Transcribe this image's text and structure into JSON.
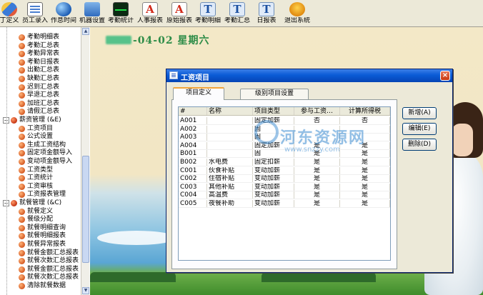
{
  "toolbar": {
    "buttons": [
      {
        "label": "丁定义",
        "icon": "users-icon"
      },
      {
        "label": "员工录入",
        "icon": "document-icon"
      },
      {
        "label": "作息时间",
        "icon": "globe-icon"
      },
      {
        "label": "机器设置",
        "icon": "computer-icon"
      },
      {
        "label": "考勤统计",
        "icon": "waveform-icon"
      },
      {
        "label": "人事报表",
        "icon": "report-a-icon"
      },
      {
        "label": "原始报表",
        "icon": "report-a-icon"
      },
      {
        "label": "考勤明细",
        "icon": "text-t-icon"
      },
      {
        "label": "考勤汇总",
        "icon": "text-t-icon"
      },
      {
        "label": "日报表",
        "icon": "text-t-icon"
      },
      {
        "label": "退出系统",
        "icon": "exit-icon"
      }
    ]
  },
  "sidebar": {
    "items": [
      {
        "label": "考勤明细表",
        "level": 2
      },
      {
        "label": "考勤汇总表",
        "level": 2
      },
      {
        "label": "考勤异常表",
        "level": 2
      },
      {
        "label": "考勤日报表",
        "level": 2
      },
      {
        "label": "出勤汇总表",
        "level": 2
      },
      {
        "label": "缺勤汇总表",
        "level": 2
      },
      {
        "label": "迟到汇总表",
        "level": 2
      },
      {
        "label": "早退汇总表",
        "level": 2
      },
      {
        "label": "加班汇总表",
        "level": 2
      },
      {
        "label": "请假汇总表",
        "level": 2
      },
      {
        "label": "薪资管理 (&E)",
        "level": 1
      },
      {
        "label": "工资项目",
        "level": 2
      },
      {
        "label": "公式设置",
        "level": 2
      },
      {
        "label": "生成工资结构",
        "level": 2
      },
      {
        "label": "固定项金额导入",
        "level": 2
      },
      {
        "label": "变动项金额导入",
        "level": 2
      },
      {
        "label": "工资类型",
        "level": 2
      },
      {
        "label": "工资统计",
        "level": 2
      },
      {
        "label": "工资审核",
        "level": 2
      },
      {
        "label": "工资报表管理",
        "level": 2
      },
      {
        "label": "就餐管理 (&C)",
        "level": 1
      },
      {
        "label": "就餐定义",
        "level": 2
      },
      {
        "label": "餐级分配",
        "level": 2
      },
      {
        "label": "就餐明细查询",
        "level": 2
      },
      {
        "label": "就餐明细报表",
        "level": 2
      },
      {
        "label": "就餐异常报表",
        "level": 2
      },
      {
        "label": "就餐金额汇总报表",
        "level": 2
      },
      {
        "label": "就餐次数汇总报表",
        "level": 2
      },
      {
        "label": "就餐金额汇总报表",
        "level": 2
      },
      {
        "label": "就餐次数汇总报表",
        "level": 2
      },
      {
        "label": "清除就餐数据",
        "level": 2
      }
    ]
  },
  "main": {
    "date_text": "-04-02 星期六"
  },
  "dialog": {
    "title": "工资项目",
    "close_label": "×",
    "tabs": [
      {
        "label": "项目定义",
        "active": true
      },
      {
        "label": "级别项目设置",
        "active": false
      }
    ],
    "columns": [
      "#",
      "名称",
      "项目类型",
      "参与工资…",
      "计算所得税"
    ],
    "rows": [
      [
        "A001",
        "",
        "固定加薪",
        "否",
        "否"
      ],
      [
        "A002",
        "",
        "固",
        "",
        ""
      ],
      [
        "A003",
        "",
        "固",
        "",
        ""
      ],
      [
        "A004",
        "",
        "固定加薪",
        "是",
        "是"
      ],
      [
        "B001",
        "",
        "固",
        "是",
        "是"
      ],
      [
        "B002",
        "水电费",
        "固定扣薪",
        "是",
        "是"
      ],
      [
        "C001",
        "伙食补贴",
        "变动加薪",
        "是",
        "是"
      ],
      [
        "C002",
        "住宿补贴",
        "变动加薪",
        "是",
        "是"
      ],
      [
        "C003",
        "其他补贴",
        "变动加薪",
        "是",
        "是"
      ],
      [
        "C004",
        "高温费",
        "变动加薪",
        "是",
        "是"
      ],
      [
        "C005",
        "夜餐补助",
        "变动加薪",
        "是",
        "是"
      ]
    ],
    "buttons": {
      "add": "新增(A)",
      "edit": "编辑(E)",
      "delete": "删除(D)"
    }
  },
  "watermark": {
    "text": "河东资源网",
    "url": "www.snzzy.com"
  },
  "colors": {
    "title_bar": "#0a5bd6",
    "date_text": "#2d8c47",
    "dialog_bg": "#ece9d8",
    "active_tab_accent": "#f2a43a"
  }
}
